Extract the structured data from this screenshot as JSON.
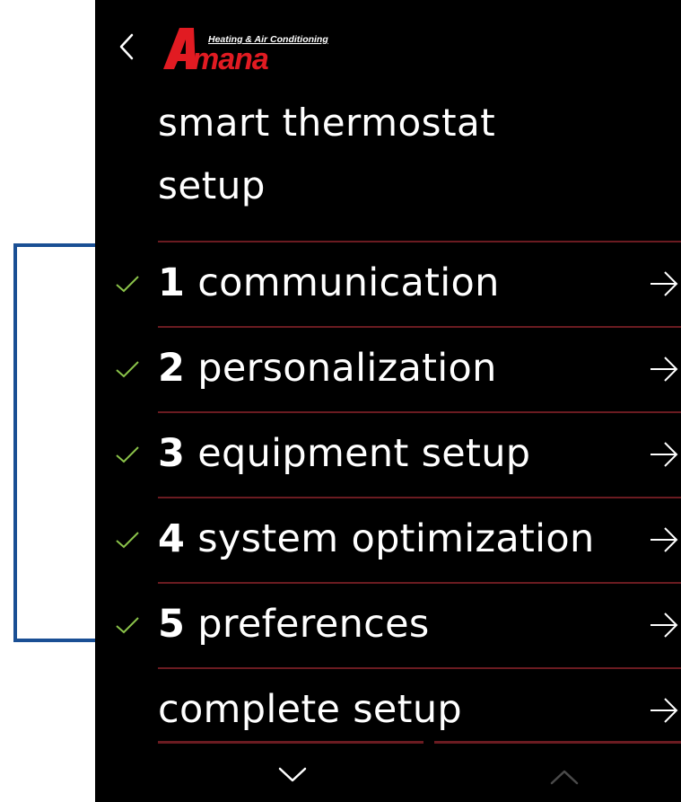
{
  "brand": {
    "logo_text": "Amana",
    "logo_tagline": "Heating & Air Conditioning",
    "logo_color": "#e11b22"
  },
  "header": {
    "title_line1": "smart thermostat",
    "title_line2": "setup"
  },
  "menu": {
    "items": [
      {
        "number": "1",
        "label": "communication",
        "completed": true
      },
      {
        "number": "2",
        "label": "personalization",
        "completed": true
      },
      {
        "number": "3",
        "label": "equipment setup",
        "completed": true
      },
      {
        "number": "4",
        "label": "system optimization",
        "completed": true
      },
      {
        "number": "5",
        "label": "preferences",
        "completed": true
      },
      {
        "number": "",
        "label": "complete setup",
        "completed": false
      }
    ]
  },
  "colors": {
    "background": "#000000",
    "divider": "#6b1b21",
    "check": "#8bc34a",
    "bracket": "#1a4f94"
  },
  "icons": {
    "back": "chevron-left-icon",
    "check": "check-icon",
    "arrow": "arrow-right-icon",
    "scroll_down": "chevron-down-icon",
    "scroll_up": "chevron-up-icon"
  }
}
